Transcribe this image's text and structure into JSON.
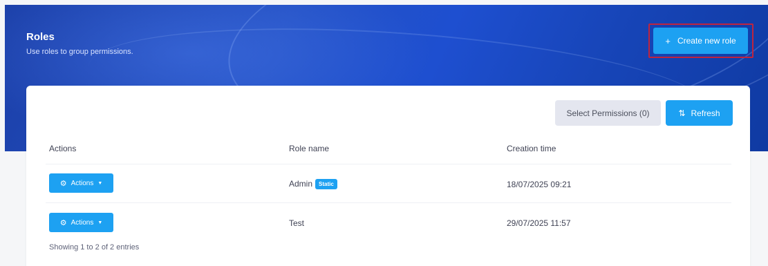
{
  "header": {
    "title": "Roles",
    "subtitle": "Use roles to group permissions.",
    "create_button_label": "Create new role",
    "create_button_icon": "plus-icon"
  },
  "toolbar": {
    "select_permissions_label": "Select Permissions (0)",
    "refresh_label": "Refresh",
    "refresh_icon": "refresh-icon"
  },
  "table": {
    "columns": [
      "Actions",
      "Role name",
      "Creation time"
    ],
    "rows": [
      {
        "actions_label": "Actions",
        "role_name": "Admin",
        "badge": "Static",
        "creation_time": "18/07/2025 09:21"
      },
      {
        "actions_label": "Actions",
        "role_name": "Test",
        "badge": "",
        "creation_time": "29/07/2025 11:57"
      }
    ]
  },
  "footer": {
    "info": "Showing 1 to 2 of 2 entries"
  },
  "colors": {
    "accent": "#1da1f2",
    "banner": "#1e4fd0",
    "highlight": "#c0243e"
  }
}
